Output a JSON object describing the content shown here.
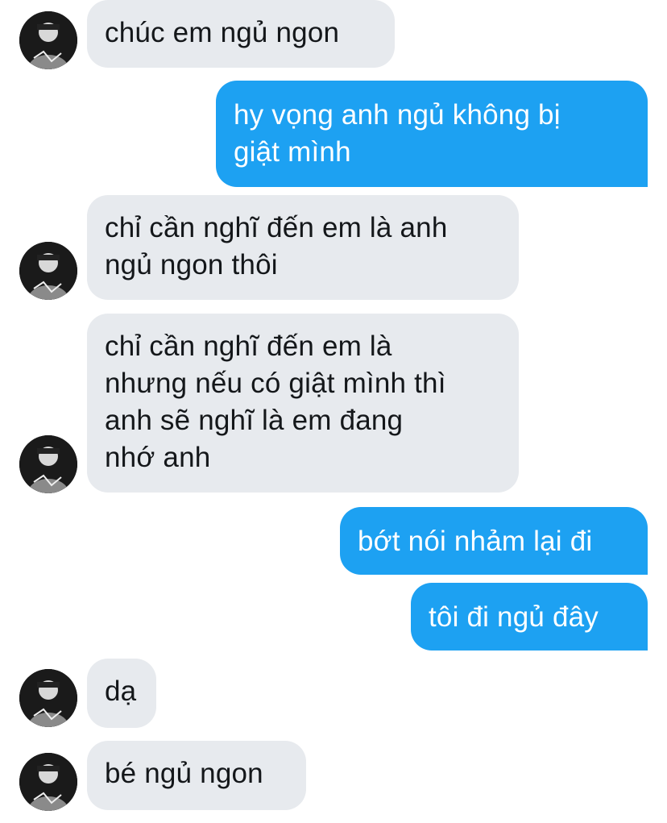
{
  "messages": [
    {
      "sender": "them",
      "text": "chúc em ngủ ngon"
    },
    {
      "sender": "me",
      "text": "hy vọng anh ngủ không bị\ngiật mình"
    },
    {
      "sender": "them",
      "text": "chỉ cần nghĩ đến em là anh\nngủ ngon thôi"
    },
    {
      "sender": "them",
      "text": "chỉ cần nghĩ đến em là\nnhưng nếu có giật mình thì\nanh sẽ nghĩ là em đang\nnhớ anh"
    },
    {
      "sender": "me",
      "text": "bớt nói nhảm lại đi"
    },
    {
      "sender": "me",
      "text": "tôi đi ngủ đây"
    },
    {
      "sender": "them",
      "text": "dạ"
    },
    {
      "sender": "them",
      "text": "bé ngủ ngon"
    }
  ],
  "colors": {
    "incoming_bubble": "#e7eaee",
    "outgoing_bubble": "#1da1f2",
    "incoming_text": "#14171a",
    "outgoing_text": "#ffffff"
  },
  "icons": {
    "avatar": "contact-avatar-icon"
  }
}
